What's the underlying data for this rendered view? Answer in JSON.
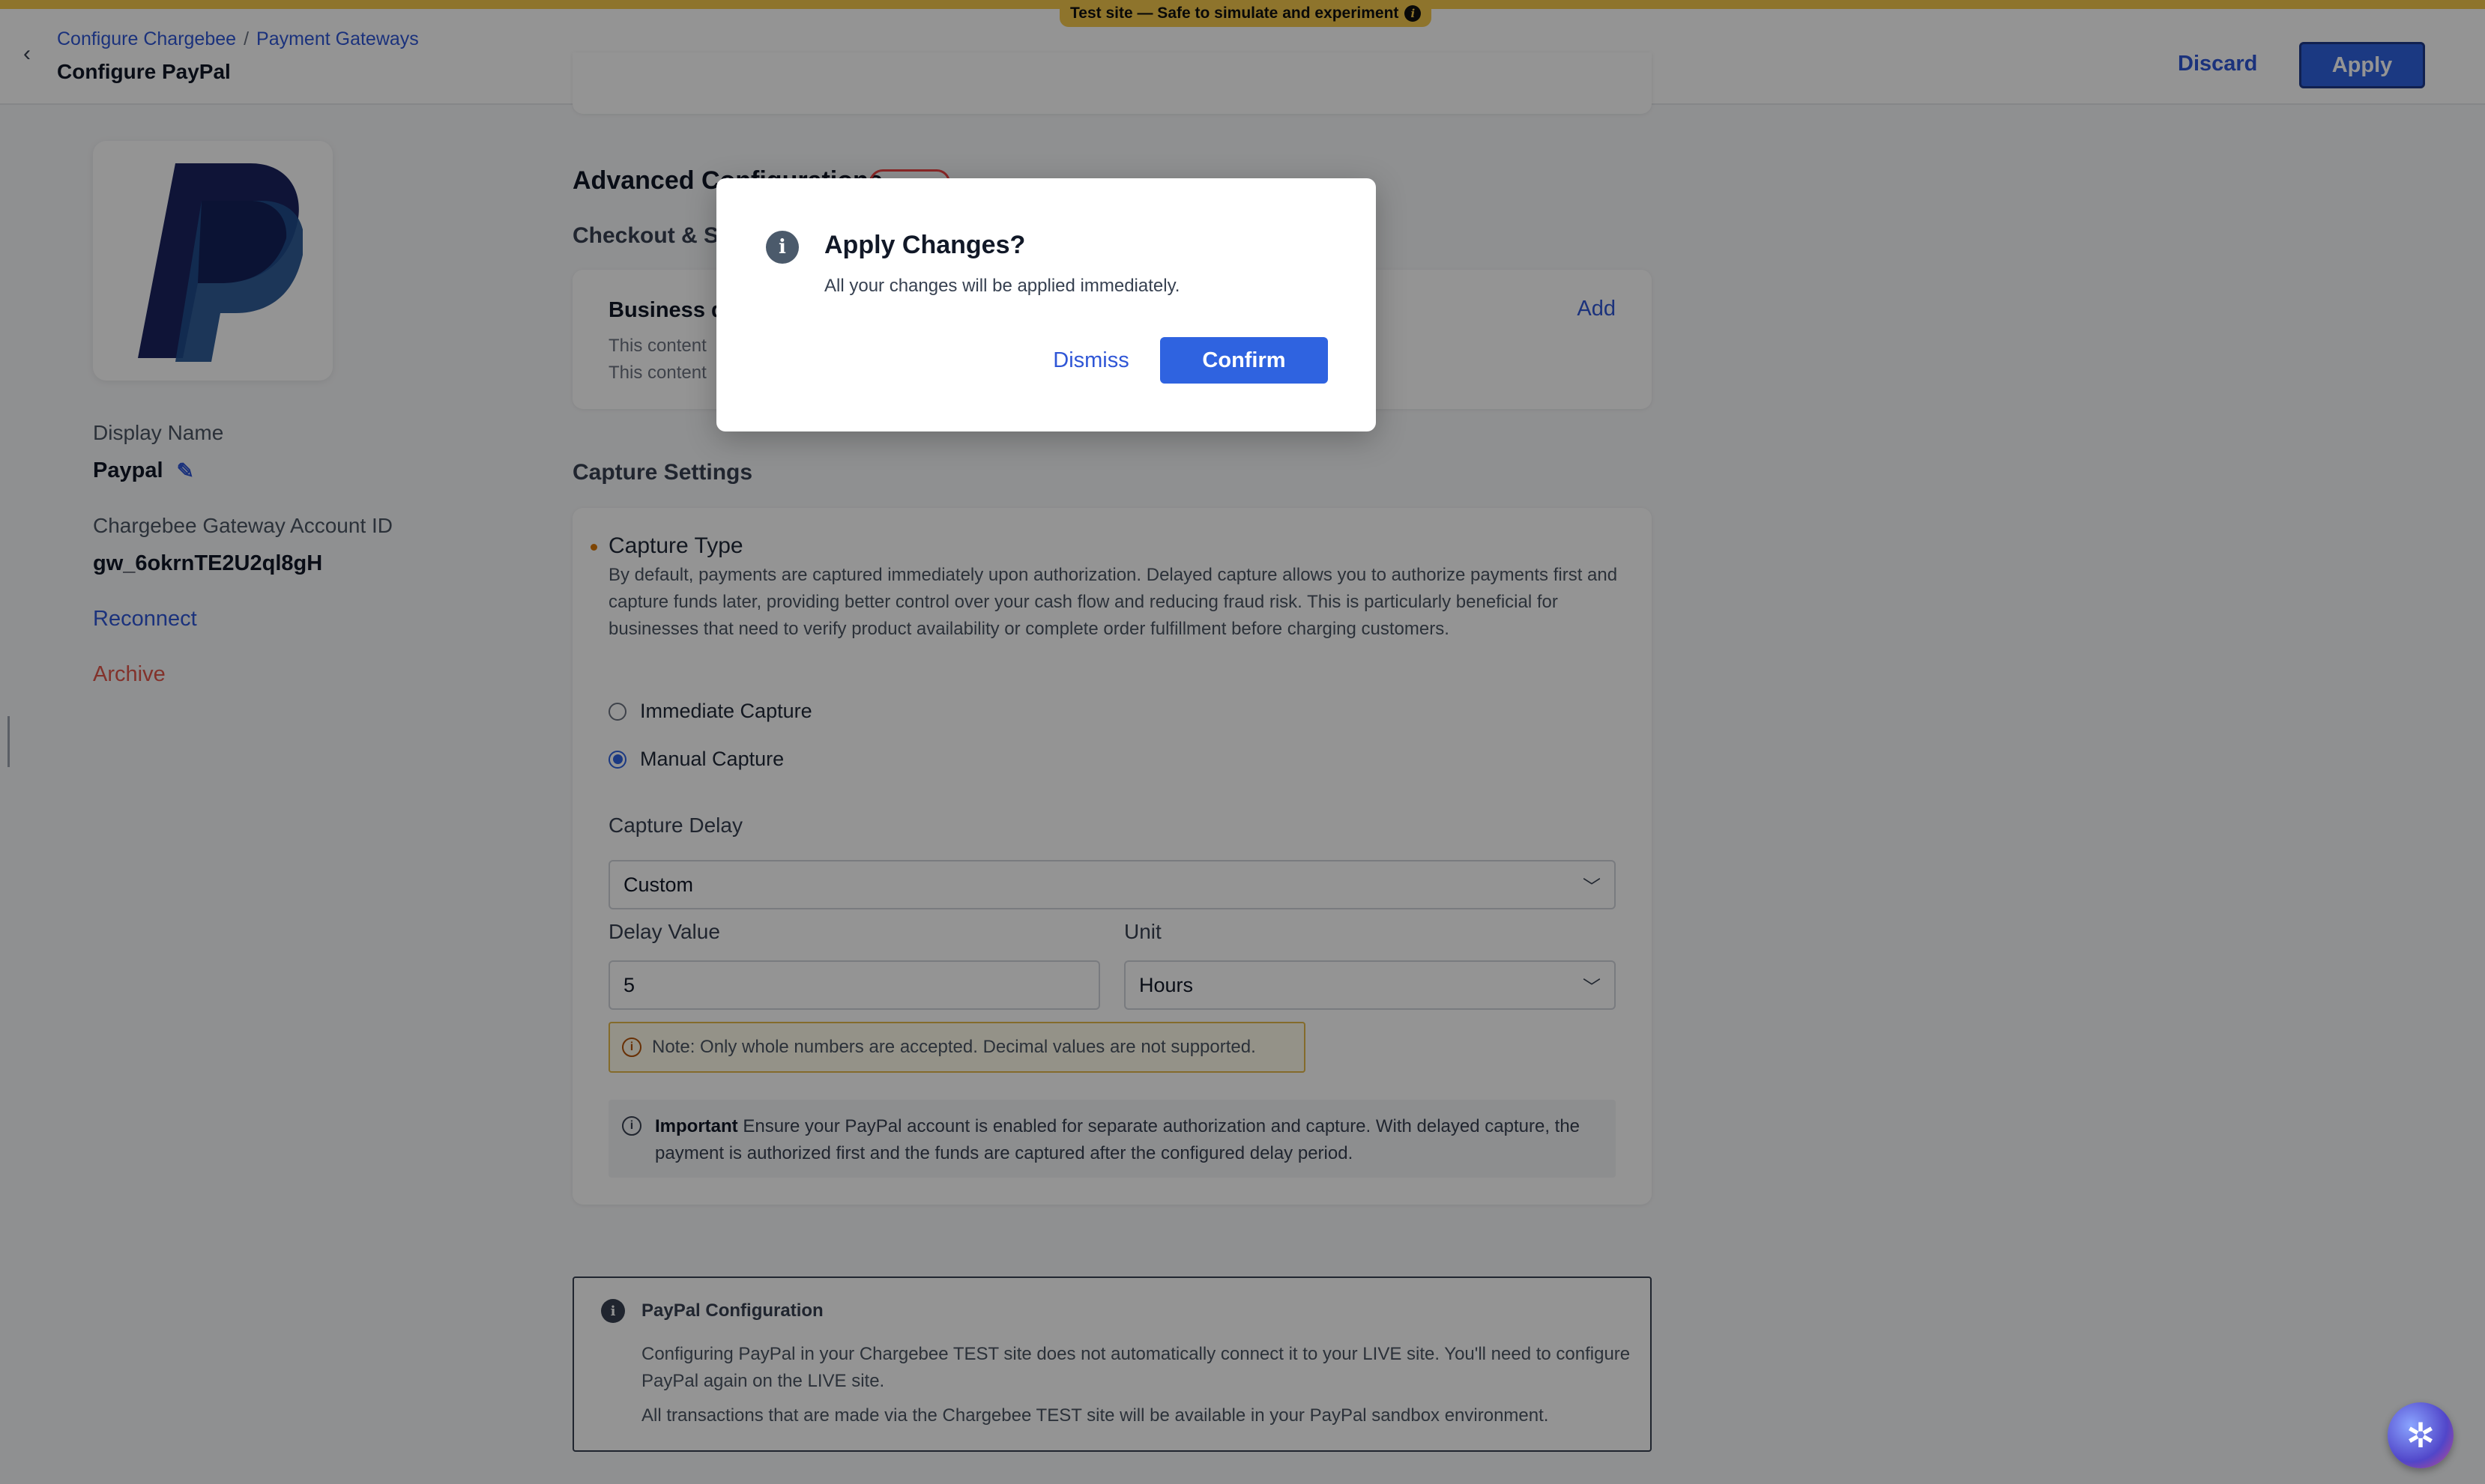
{
  "test_banner": {
    "label": "Test site — Safe to simulate and experiment"
  },
  "header": {
    "breadcrumb": [
      "Configure Chargebee",
      "Payment Gateways"
    ],
    "breadcrumb_separator": "/",
    "title": "Configure PayPal",
    "discard_label": "Discard",
    "apply_label": "Apply"
  },
  "gateway": {
    "display_name_label": "Display Name",
    "display_name": "Paypal",
    "account_id_label": "Chargebee Gateway Account ID",
    "account_id": "gw_6okrnTE2U2ql8gH",
    "reconnect_label": "Reconnect",
    "archive_label": "Archive"
  },
  "advanced": {
    "heading": "Advanced Configurations",
    "checkout_heading": "Checkout & Se",
    "business_title": "Business d",
    "business_line1": "This content",
    "business_line2": "This content",
    "add_label": "Add"
  },
  "capture": {
    "heading": "Capture Settings",
    "type_title": "Capture Type",
    "type_description": "By default, payments are captured immediately upon authorization. Delayed capture allows you to authorize payments first and capture funds later, providing better control over your cash flow and reducing fraud risk. This is particularly beneficial for businesses that need to verify product availability or complete order fulfillment before charging customers.",
    "options": [
      "Immediate Capture",
      "Manual Capture"
    ],
    "selected_option": "Manual Capture",
    "delay_label": "Capture Delay",
    "delay_value_selected": "Custom",
    "delay_value_label": "Delay Value",
    "delay_value": "5",
    "unit_label": "Unit",
    "unit_selected": "Hours",
    "note": "Note: Only whole numbers are accepted. Decimal values are not supported.",
    "important_bold": "Important",
    "important_text": " Ensure your PayPal account is enabled for separate authorization and capture. With delayed capture, the payment is authorized first and the funds are captured after the configured delay period."
  },
  "paypal_config": {
    "title": "PayPal Configuration",
    "text1": "Configuring PayPal in your Chargebee TEST site does not automatically connect it to your LIVE site. You'll need to configure PayPal again on the LIVE site.",
    "text2": "All transactions that are made via the Chargebee TEST site will be available in your PayPal sandbox environment."
  },
  "modal": {
    "title": "Apply Changes?",
    "body": "All your changes will be applied immediately.",
    "dismiss_label": "Dismiss",
    "confirm_label": "Confirm"
  },
  "colors": {
    "accent": "#2f63e0",
    "link": "#2f56d6",
    "test_banner": "#f5c84c",
    "danger": "#e0564a",
    "paypal_dark": "#1a2460",
    "paypal_light": "#1f4f8f"
  },
  "icons": {
    "back": "chevron-left-icon",
    "banner_info": "info-icon",
    "edit": "pencil-icon",
    "modal_info": "info-icon",
    "assistant": "assistant-fab-icon"
  }
}
